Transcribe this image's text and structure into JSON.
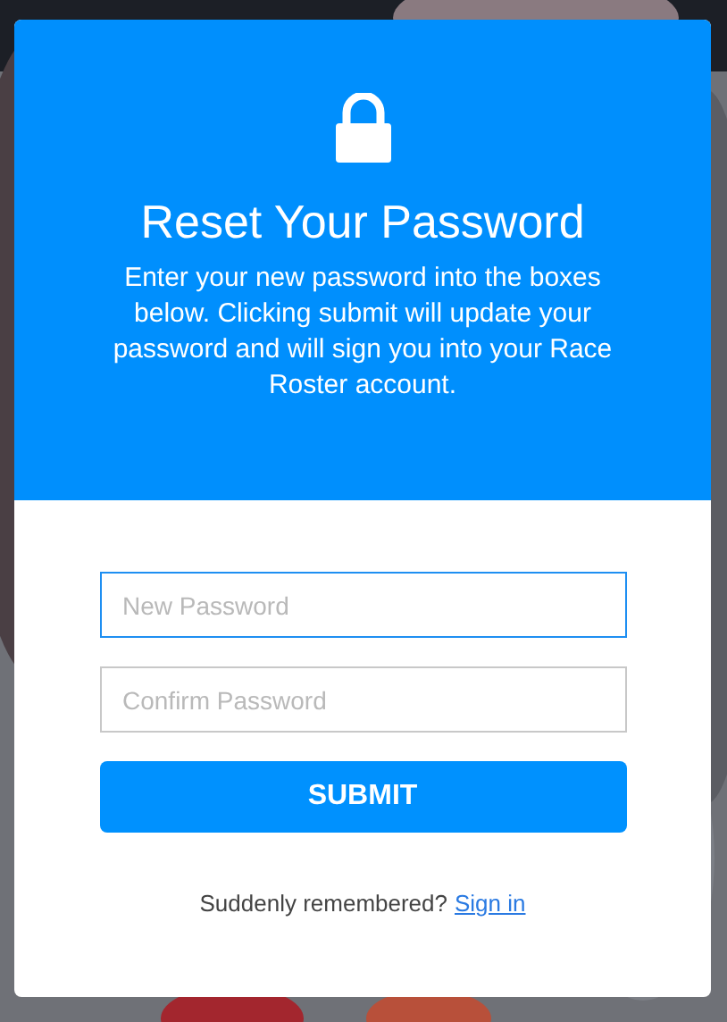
{
  "header": {
    "title": "Reset Your Password",
    "description": "Enter your new password into the boxes below. Clicking submit will update your password and will sign you into your Race Roster account."
  },
  "fields": [
    {
      "placeholder": "New Password",
      "focused": true
    },
    {
      "placeholder": "Confirm Password",
      "focused": false
    }
  ],
  "submit_button": "SUBMIT",
  "footer": {
    "text": "Suddenly remembered?",
    "link": "Sign in"
  }
}
